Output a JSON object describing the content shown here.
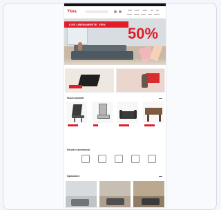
{
  "site": {
    "brand": "Ykea",
    "search_placeholder": ""
  },
  "hero": {
    "banner_text": "LIVE LIBERAMENTE. VIEN",
    "discount_text": "50%",
    "colors": {
      "red": "#e01e2b",
      "black": "#111111"
    }
  },
  "sections": {
    "products_title": "Nuovi prodotti",
    "services_title": "Servizi e assistenza",
    "inspiration_title": "Ispirazione"
  },
  "products": [
    {
      "name": "",
      "price": ""
    },
    {
      "name": "",
      "price": ""
    },
    {
      "name": "",
      "price": ""
    },
    {
      "name": "",
      "price": ""
    }
  ],
  "services": [
    {
      "label": ""
    },
    {
      "label": ""
    },
    {
      "label": ""
    },
    {
      "label": ""
    },
    {
      "label": ""
    }
  ],
  "icons": {
    "search": "search-icon",
    "user": "user-icon",
    "cart": "cart-icon",
    "favorite": "heart-icon"
  }
}
